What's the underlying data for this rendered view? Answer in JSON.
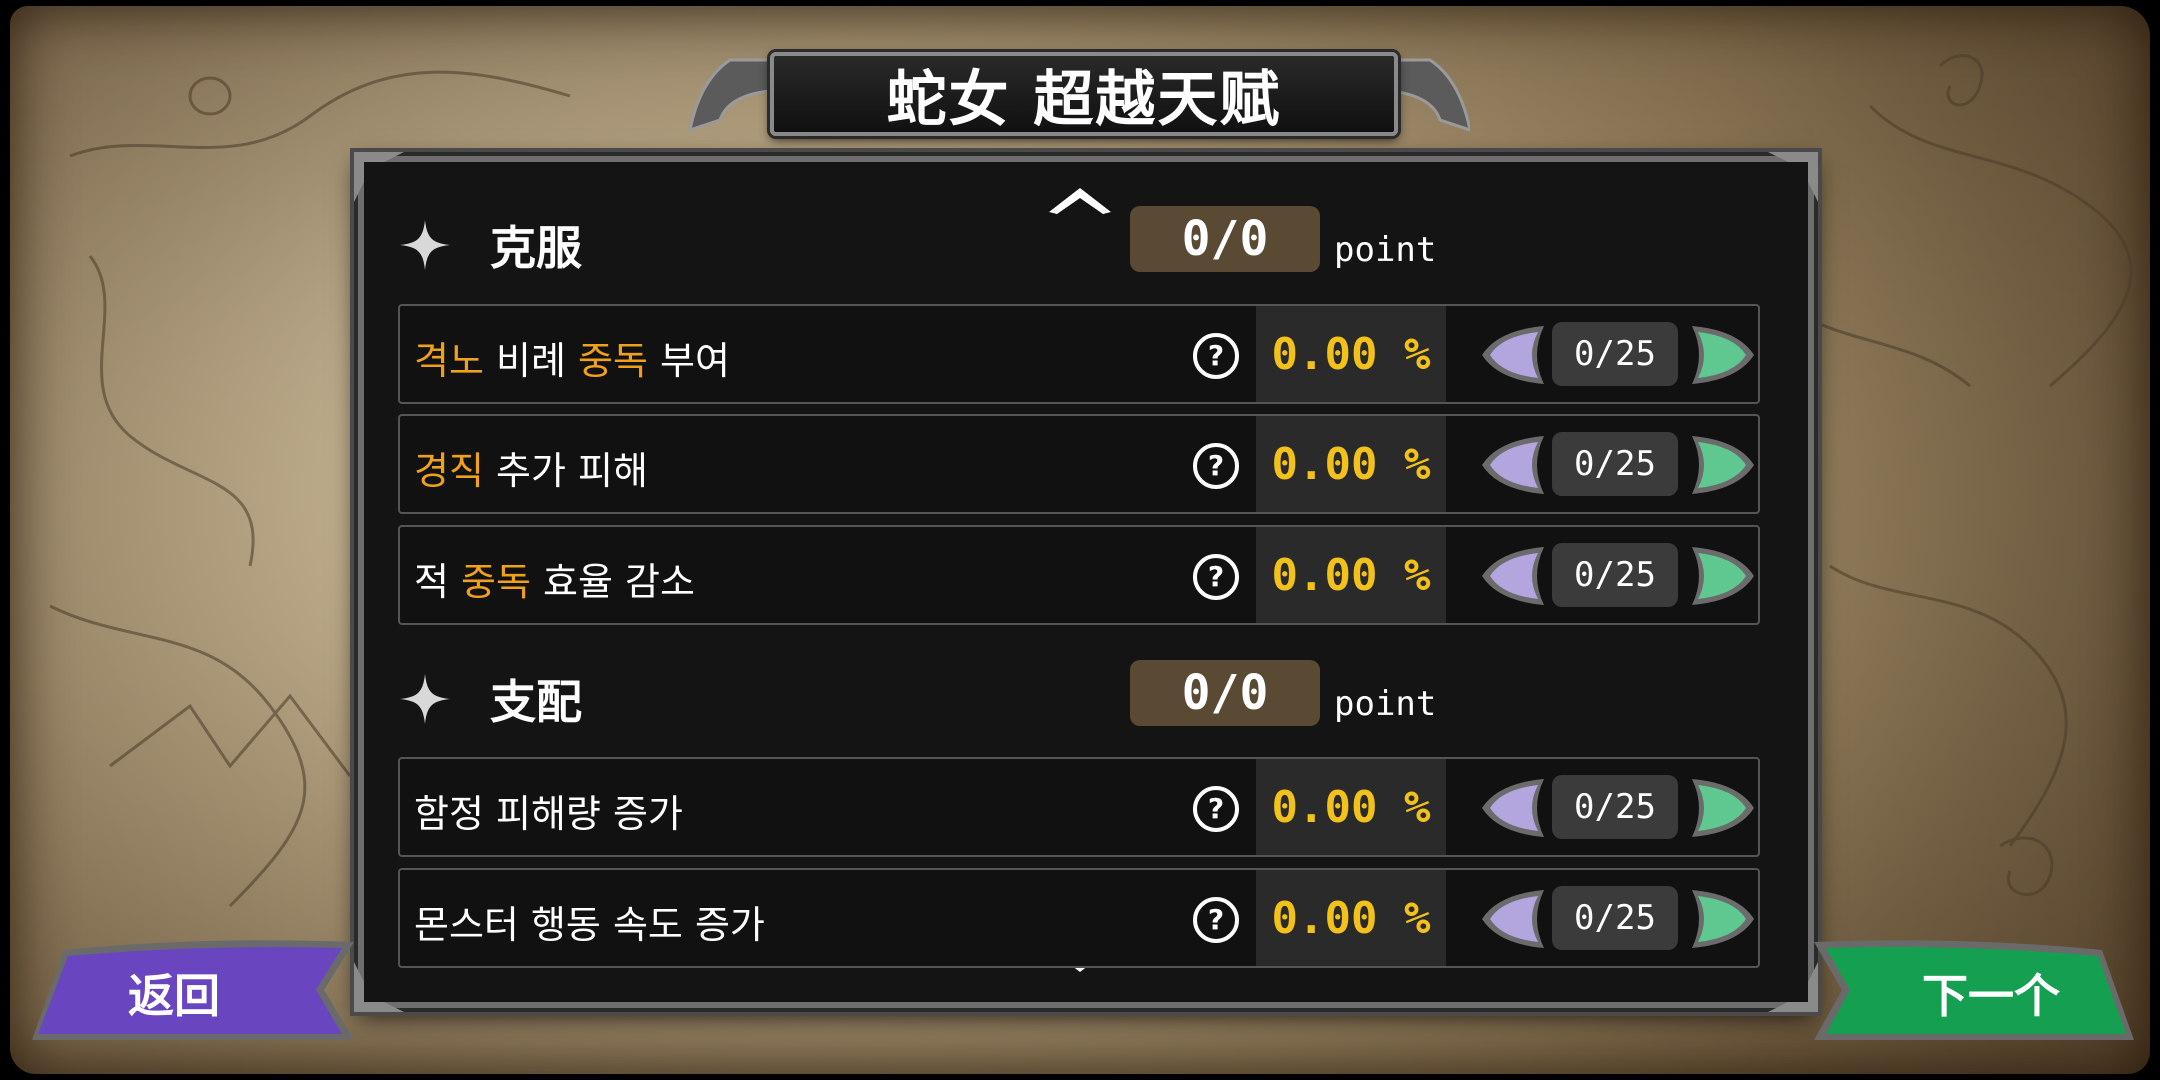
{
  "title": "蛇女 超越天赋",
  "colors": {
    "highlight": "#f0a11a",
    "percent": "#f2c21a",
    "decrease_button": "#b3a6df",
    "increase_button": "#5fc890",
    "back_button": "#6a45c0",
    "next_button": "#14a050"
  },
  "scroll": {
    "up_icon": "chevron-up-icon",
    "down_icon": "chevron-down-icon"
  },
  "sections": [
    {
      "label": "克服",
      "points": "0/0",
      "unit": "point",
      "rows": [
        {
          "parts": [
            {
              "text": "격노",
              "hl": true
            },
            {
              "text": " 비례 ",
              "hl": false
            },
            {
              "text": "중독",
              "hl": true
            },
            {
              "text": " 부여",
              "hl": false
            }
          ],
          "percent": "0.00 %",
          "level": "0/25"
        },
        {
          "parts": [
            {
              "text": "경직",
              "hl": true
            },
            {
              "text": " 추가 피해",
              "hl": false
            }
          ],
          "percent": "0.00 %",
          "level": "0/25"
        },
        {
          "parts": [
            {
              "text": "적 ",
              "hl": false
            },
            {
              "text": "중독",
              "hl": true
            },
            {
              "text": " 효율 감소",
              "hl": false
            }
          ],
          "percent": "0.00 %",
          "level": "0/25"
        }
      ]
    },
    {
      "label": "支配",
      "points": "0/0",
      "unit": "point",
      "rows": [
        {
          "parts": [
            {
              "text": "함정 피해량 증가",
              "hl": false
            }
          ],
          "percent": "0.00 %",
          "level": "0/25"
        },
        {
          "parts": [
            {
              "text": "몬스터 행동 속도 증가",
              "hl": false
            }
          ],
          "percent": "0.00 %",
          "level": "0/25"
        }
      ]
    }
  ],
  "buttons": {
    "back": "返回",
    "next": "下一个"
  }
}
